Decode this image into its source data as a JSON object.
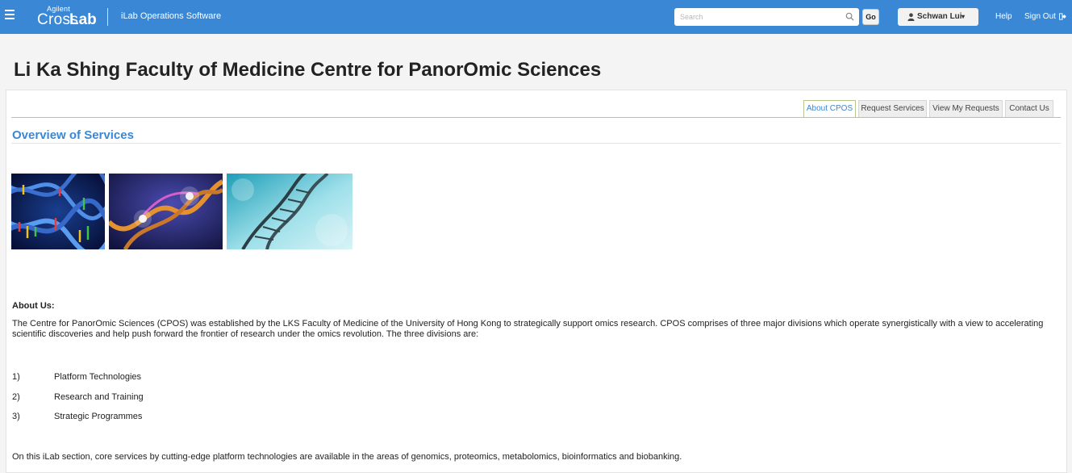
{
  "header": {
    "logo_top": "Agilent",
    "logo_cross": "Cross",
    "logo_lab": "Lab",
    "app_name": "iLab Operations Software",
    "search_placeholder": "Search",
    "go_label": "Go",
    "user_name": "Schwan Lui",
    "help_label": "Help",
    "signout_label": "Sign Out",
    "bar_color": "#3a87d6"
  },
  "page": {
    "title": "Li Ka Shing Faculty of Medicine Centre for PanorOmic Sciences"
  },
  "tabs": [
    {
      "label": "About CPOS",
      "active": true
    },
    {
      "label": "Request Services",
      "active": false
    },
    {
      "label": "View My Requests",
      "active": false
    },
    {
      "label": "Contact Us",
      "active": false
    }
  ],
  "overview": {
    "title": "Overview of Services"
  },
  "about": {
    "heading": "About Us:",
    "paragraph": "The Centre for PanorOmic Sciences (CPOS) was established by the LKS Faculty of Medicine of the University of Hong Kong to strategically support omics research.  CPOS comprises of three major divisions which operate synergistically with a view to accelerating scientific discoveries and help push forward the frontier of research under the omics revolution.  The three divisions are:",
    "divisions": [
      {
        "num": "1)",
        "text": "Platform Technologies"
      },
      {
        "num": "2)",
        "text": "Research and Training"
      },
      {
        "num": "3)",
        "text": "Strategic Programmes"
      }
    ],
    "footer_text": "On this iLab section, core services by cutting-edge platform technologies are available in the areas of genomics, proteomics, metabolomics, bioinformatics and biobanking."
  },
  "icons": {
    "menu": "hamburger-icon",
    "search": "search-icon",
    "user": "user-icon",
    "signout": "sign-out-icon"
  }
}
